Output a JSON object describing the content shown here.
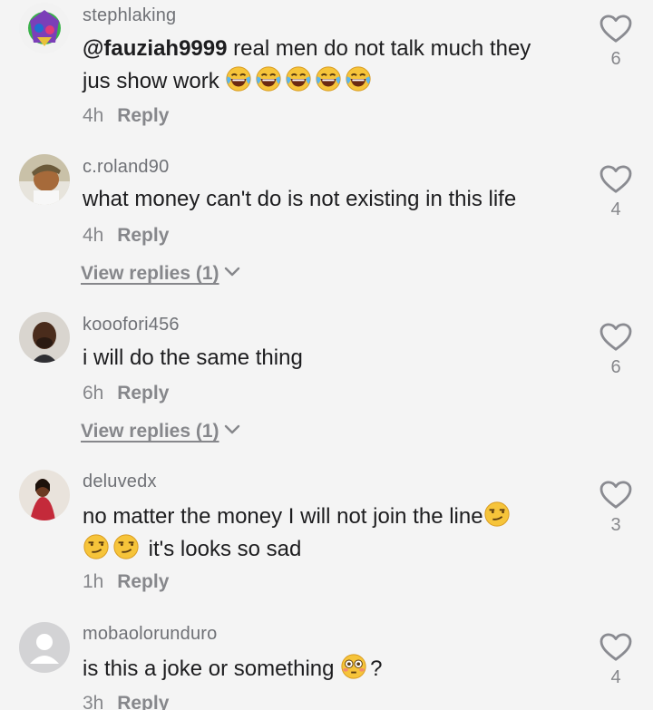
{
  "comments": [
    {
      "username": "stephlaking",
      "mention": "@fauziah9999",
      "text_line1": " real men do not talk much they",
      "text_line2": "jus show work",
      "emojis": [
        "joy-emoji",
        "joy-emoji",
        "joy-emoji",
        "joy-emoji",
        "joy-emoji"
      ],
      "time": "4h",
      "reply_label": "Reply",
      "likes": "6"
    },
    {
      "username": "c.roland90",
      "text": "what money can't do is not existing in this life",
      "time": "4h",
      "reply_label": "Reply",
      "view_replies": "View replies (1)",
      "likes": "4"
    },
    {
      "username": "kooofori456",
      "text": "i will do the same thing",
      "time": "6h",
      "reply_label": "Reply",
      "view_replies": "View replies (1)",
      "likes": "6"
    },
    {
      "username": "deluvedx",
      "text_line1": "no matter the money I will not join the line",
      "text_line2": " it's looks so sad",
      "emojis": [
        "smirk-emoji",
        "smirk-emoji",
        "smirk-emoji"
      ],
      "time": "1h",
      "reply_label": "Reply",
      "likes": "3"
    },
    {
      "username": "mobaolorunduro",
      "text": "is this a joke or something ",
      "text_suffix": "?",
      "emojis": [
        "flushed-emoji"
      ],
      "time": "3h",
      "reply_label": "Reply",
      "likes": "4"
    }
  ],
  "colors": {
    "background": "#f4f4f4",
    "username": "#6f7176",
    "text": "#1d1d1f",
    "muted": "#86878b",
    "heart_stroke": "#8a8b91"
  }
}
